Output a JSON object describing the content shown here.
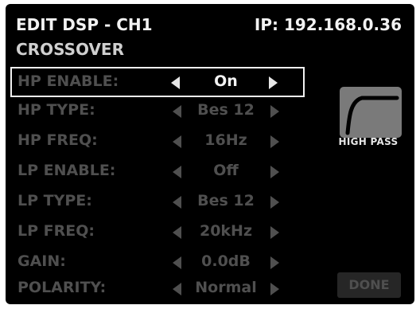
{
  "header": {
    "title": "EDIT DSP - CH1",
    "ip": "IP: 192.168.0.36",
    "section": "CROSSOVER"
  },
  "rows": [
    {
      "label": "HP ENABLE:",
      "value": "On",
      "selected": true
    },
    {
      "label": "HP TYPE:",
      "value": "Bes 12"
    },
    {
      "label": "HP FREQ:",
      "value": "16Hz"
    },
    {
      "label": "LP ENABLE:",
      "value": "Off"
    },
    {
      "label": "LP TYPE:",
      "value": "Bes 12"
    },
    {
      "label": "LP FREQ:",
      "value": "20kHz"
    },
    {
      "label": "GAIN:",
      "value": "0.0dB"
    },
    {
      "label": "POLARITY:",
      "value": "Normal"
    }
  ],
  "graph": {
    "label": "HIGH PASS",
    "icon": "high-pass-curve-icon"
  },
  "done_label": "DONE",
  "colors": {
    "background": "#000000",
    "text_active": "#f2f2f2",
    "text_dim": "#4f4f4f"
  }
}
